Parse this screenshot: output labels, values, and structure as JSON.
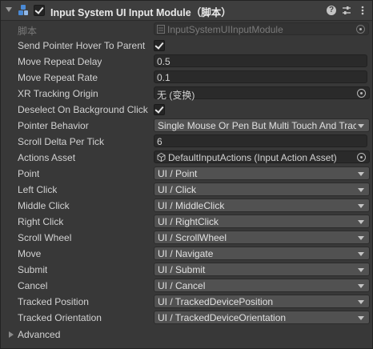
{
  "header": {
    "title": "Input System UI Input Module（脚本）",
    "enabled": true,
    "icons": [
      "script-icon",
      "help-icon",
      "preset-icon",
      "more-icon"
    ]
  },
  "rows": {
    "script": {
      "label": "脚本",
      "value": "InputSystemUIInputModule"
    },
    "send_pointer_hover": {
      "label": "Send Pointer Hover To Parent",
      "checked": true
    },
    "move_repeat_delay": {
      "label": "Move Repeat Delay",
      "value": "0.5"
    },
    "move_repeat_rate": {
      "label": "Move Repeat Rate",
      "value": "0.1"
    },
    "xr_tracking_origin": {
      "label": "XR Tracking Origin",
      "value": "无 (变换)"
    },
    "deselect_on_background": {
      "label": "Deselect On Background Click",
      "checked": true
    },
    "pointer_behavior": {
      "label": "Pointer Behavior",
      "value": "Single Mouse Or Pen But Multi Touch And Track"
    },
    "scroll_delta": {
      "label": "Scroll Delta Per Tick",
      "value": "6"
    },
    "actions_asset": {
      "label": "Actions Asset",
      "value": "DefaultInputActions (Input Action Asset)"
    },
    "point": {
      "label": "Point",
      "value": "UI / Point"
    },
    "left_click": {
      "label": "Left Click",
      "value": "UI / Click"
    },
    "middle_click": {
      "label": "Middle Click",
      "value": "UI / MiddleClick"
    },
    "right_click": {
      "label": "Right Click",
      "value": "UI / RightClick"
    },
    "scroll_wheel": {
      "label": "Scroll Wheel",
      "value": "UI / ScrollWheel"
    },
    "move": {
      "label": "Move",
      "value": "UI / Navigate"
    },
    "submit": {
      "label": "Submit",
      "value": "UI / Submit"
    },
    "cancel": {
      "label": "Cancel",
      "value": "UI / Cancel"
    },
    "tracked_position": {
      "label": "Tracked Position",
      "value": "UI / TrackedDevicePosition"
    },
    "tracked_orientation": {
      "label": "Tracked Orientation",
      "value": "UI / TrackedDeviceOrientation"
    }
  },
  "advanced": {
    "label": "Advanced"
  }
}
